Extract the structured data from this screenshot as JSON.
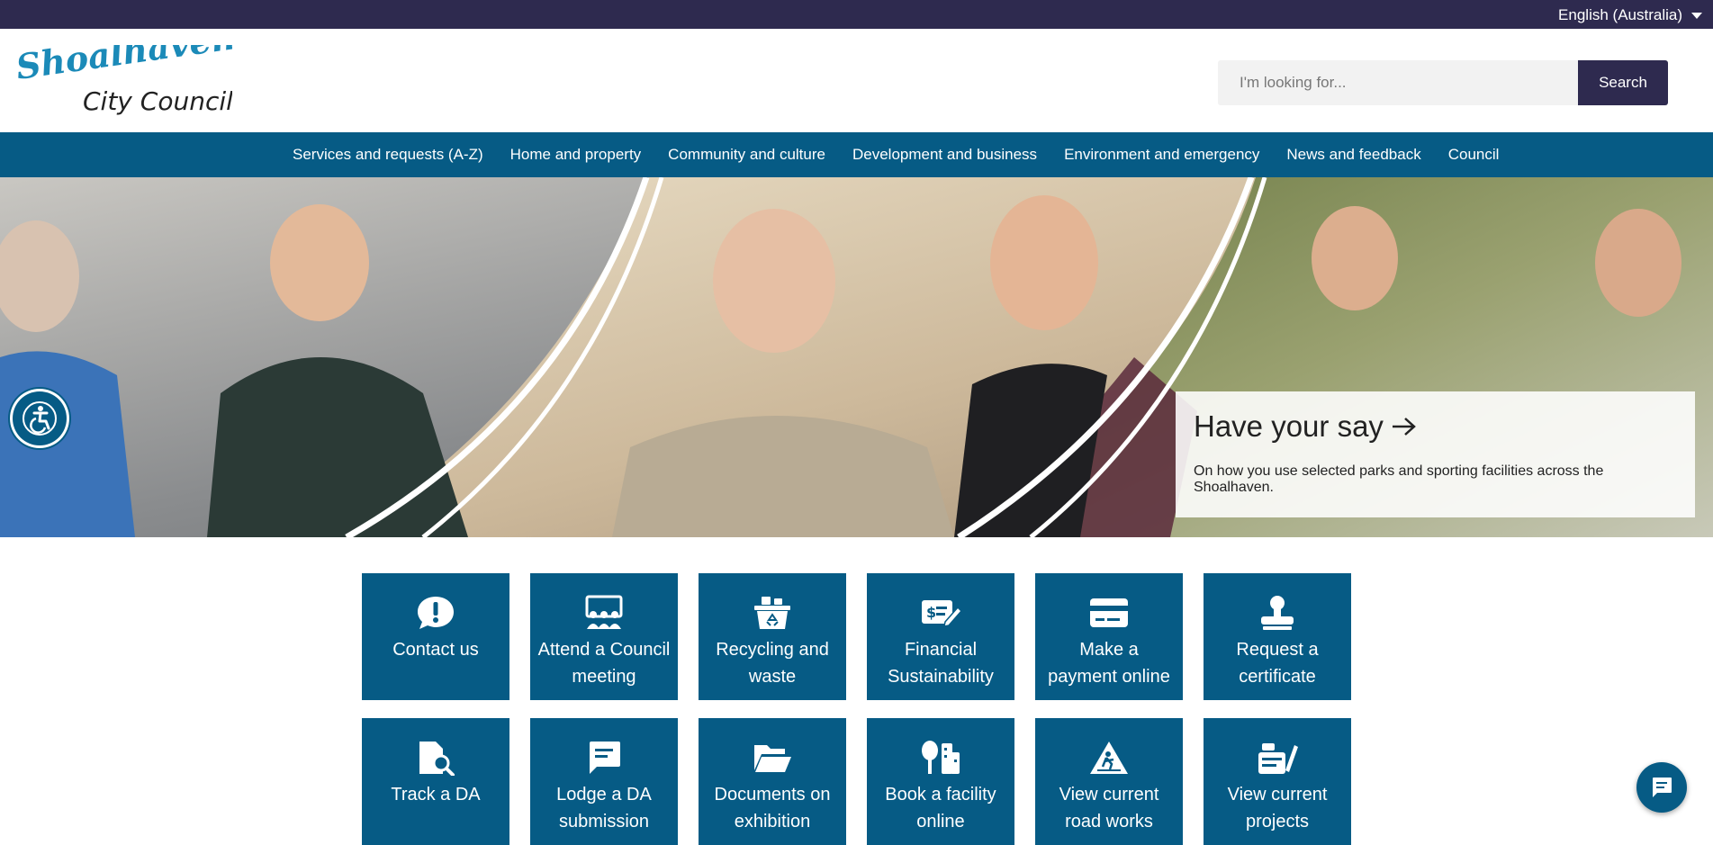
{
  "topbar": {
    "language": "English (Australia)"
  },
  "header": {
    "logo_line1": "Shoalhaven",
    "logo_line2": "City Council",
    "search_placeholder": "I'm looking for...",
    "search_button": "Search"
  },
  "nav": {
    "items": [
      "Services and requests (A-Z)",
      "Home and property",
      "Community and culture",
      "Development and business",
      "Environment and emergency",
      "News and feedback",
      "Council"
    ]
  },
  "hero": {
    "callout_title": "Have your say",
    "callout_text": "On how you use selected parks and sporting facilities across the Shoalhaven."
  },
  "tiles": [
    {
      "line1": "Contact us",
      "line2": "",
      "icon": "exclamation-chat-icon"
    },
    {
      "line1": "Attend a Council",
      "line2": "meeting",
      "icon": "meeting-icon"
    },
    {
      "line1": "Recycling and",
      "line2": "waste",
      "icon": "recycling-bin-icon"
    },
    {
      "line1": "Financial",
      "line2": "Sustainability",
      "icon": "finance-icon"
    },
    {
      "line1": "Make a",
      "line2": "payment online",
      "icon": "credit-card-icon"
    },
    {
      "line1": "Request a",
      "line2": "certificate",
      "icon": "stamp-icon"
    },
    {
      "line1": "Track a DA",
      "line2": "",
      "icon": "document-search-icon"
    },
    {
      "line1": "Lodge a DA",
      "line2": "submission",
      "icon": "message-icon"
    },
    {
      "line1": "Documents on",
      "line2": "exhibition",
      "icon": "folder-open-icon"
    },
    {
      "line1": "Book a facility",
      "line2": "online",
      "icon": "facility-icon"
    },
    {
      "line1": "View current",
      "line2": "road works",
      "icon": "road-works-icon"
    },
    {
      "line1": "View current",
      "line2": "projects",
      "icon": "projects-icon"
    }
  ],
  "colors": {
    "topbar": "#2e2a4f",
    "nav": "#065b85",
    "tile": "#065b85",
    "logo_blue": "#1b8ab8"
  }
}
